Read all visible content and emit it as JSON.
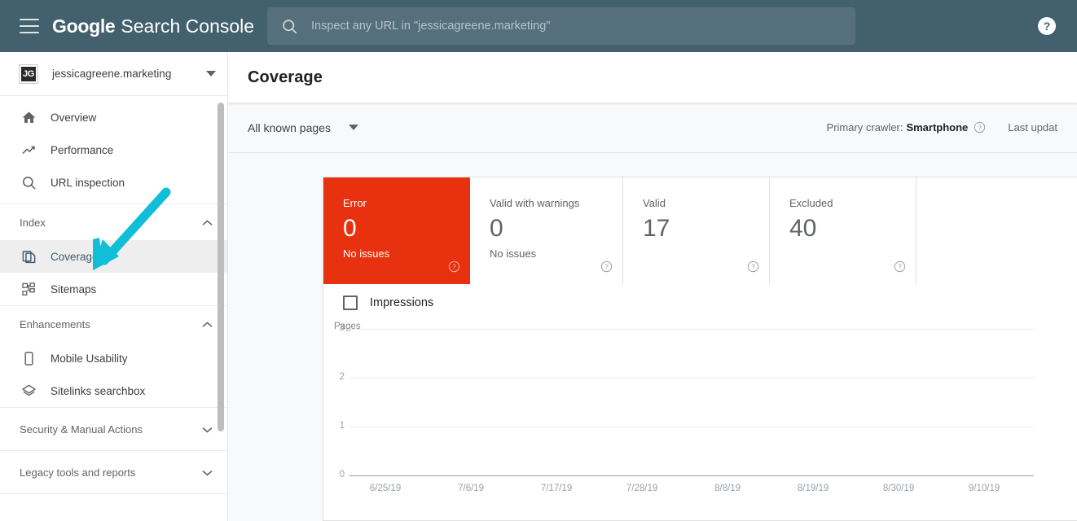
{
  "topbar": {
    "menu_icon": "hamburger-menu-icon",
    "brand_google": "Google",
    "brand_product": "Search Console",
    "search_placeholder": "Inspect any URL in \"jessicagreene.marketing\"",
    "search_value": "",
    "search_icon": "search-icon",
    "help_icon": "help-circle-icon",
    "bg_color": "#43606e",
    "search_bg_color": "#566f7c"
  },
  "sidebar": {
    "property": {
      "avatar_initials": "JG",
      "name": "jessicagreene.marketing",
      "caret_icon": "chevron-down-icon"
    },
    "primary_items": [
      {
        "label": "Overview",
        "icon": "home-icon",
        "selected": false
      },
      {
        "label": "Performance",
        "icon": "trending-up-icon",
        "selected": false
      },
      {
        "label": "URL inspection",
        "icon": "search-icon",
        "selected": false
      }
    ],
    "sections": [
      {
        "title": "Index",
        "expanded": true,
        "caret_icon": "chevron-up-icon",
        "items": [
          {
            "label": "Coverage",
            "icon": "pages-copy-icon",
            "selected": true
          },
          {
            "label": "Sitemaps",
            "icon": "sitemap-tree-icon",
            "selected": false
          }
        ]
      },
      {
        "title": "Enhancements",
        "expanded": true,
        "caret_icon": "chevron-up-icon",
        "items": [
          {
            "label": "Mobile Usability",
            "icon": "mobile-phone-icon",
            "selected": false
          },
          {
            "label": "Sitelinks searchbox",
            "icon": "layers-icon",
            "selected": false
          }
        ]
      },
      {
        "title": "Security & Manual Actions",
        "expanded": false,
        "caret_icon": "chevron-down-icon",
        "items": []
      },
      {
        "title": "Legacy tools and reports",
        "expanded": false,
        "caret_icon": "chevron-down-icon",
        "items": []
      }
    ],
    "scrollbar_visible": true
  },
  "page": {
    "title": "Coverage"
  },
  "toolbar": {
    "scope_dropdown": "All known pages",
    "scope_caret_icon": "chevron-down-icon",
    "crawler_label": "Primary crawler:",
    "crawler_value": "Smartphone",
    "crawler_help_icon": "help-circle-outline-icon",
    "last_updated": "Last updat"
  },
  "cards": [
    {
      "label": "Error",
      "value": "0",
      "sub": "No issues",
      "state": "error",
      "help_icon": "help-circle-outline-icon"
    },
    {
      "label": "Valid with warnings",
      "value": "0",
      "sub": "No issues",
      "state": "warning",
      "help_icon": "help-circle-outline-icon"
    },
    {
      "label": "Valid",
      "value": "17",
      "sub": "",
      "state": "valid",
      "help_icon": "help-circle-outline-icon"
    },
    {
      "label": "Excluded",
      "value": "40",
      "sub": "",
      "state": "excluded",
      "help_icon": "help-circle-outline-icon"
    }
  ],
  "colors": {
    "error_red": "#e8310f",
    "header_teal": "#43606e",
    "annotation_cyan": "#10bed8",
    "selected_nav_bg": "#eeeeee",
    "content_bg": "#f8f9fa"
  },
  "legend": {
    "impressions_label": "Impressions",
    "impressions_checked": false
  },
  "chart_data": {
    "type": "line",
    "title": "",
    "xlabel": "",
    "ylabel": "Pages",
    "ylim": [
      0,
      3
    ],
    "yticks": [
      "3",
      "2",
      "1",
      "0"
    ],
    "grid": true,
    "legend_position": "top-left",
    "x": [
      "6/25/19",
      "7/6/19",
      "7/17/19",
      "7/28/19",
      "8/8/19",
      "8/19/19",
      "8/30/19",
      "9/10/19"
    ],
    "series": [
      {
        "name": "Error",
        "values": [
          0,
          0,
          0,
          0,
          0,
          0,
          0,
          0
        ],
        "color": "#e8310f"
      }
    ]
  },
  "annotation": {
    "arrow_target": "sidebar-item-coverage",
    "color": "#10bed8"
  }
}
